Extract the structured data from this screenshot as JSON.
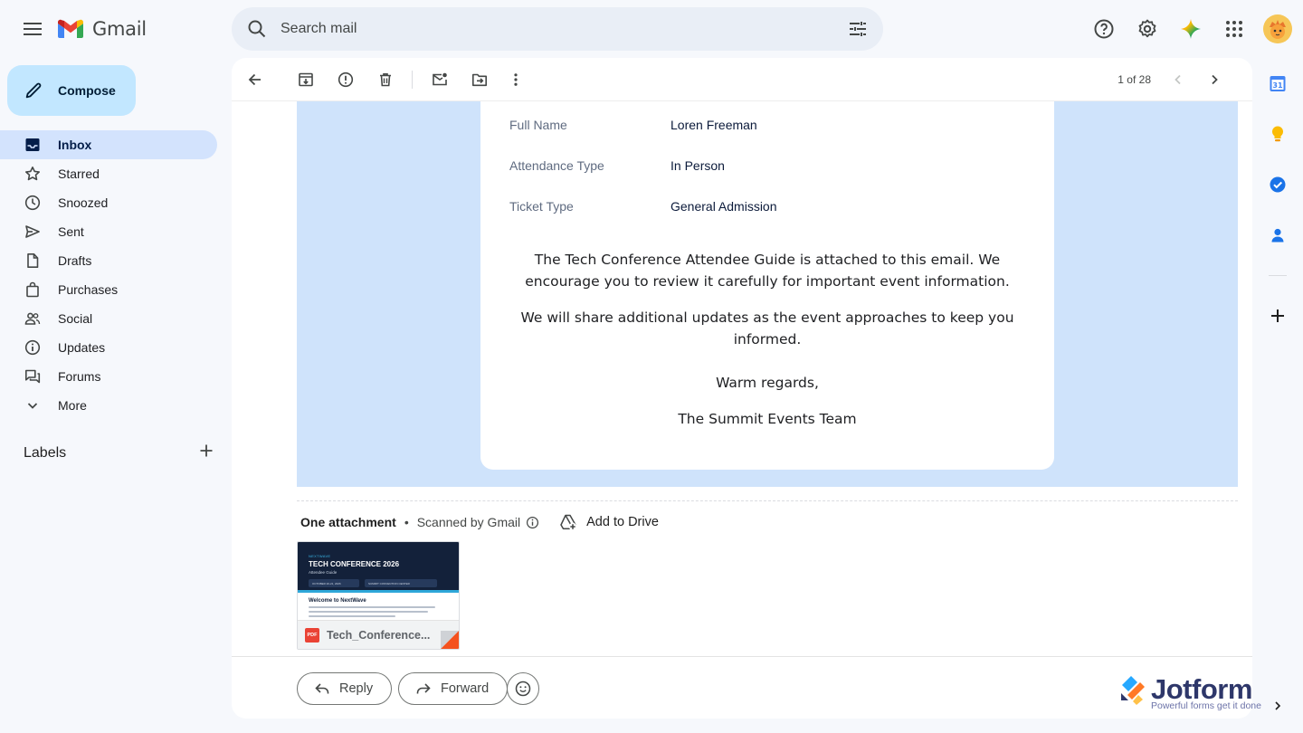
{
  "app": {
    "name": "Gmail"
  },
  "search": {
    "placeholder": "Search mail"
  },
  "compose": {
    "label": "Compose"
  },
  "nav": [
    {
      "label": "Inbox",
      "icon": "inbox-icon",
      "active": true
    },
    {
      "label": "Starred",
      "icon": "star-icon"
    },
    {
      "label": "Snoozed",
      "icon": "clock-icon"
    },
    {
      "label": "Sent",
      "icon": "send-icon"
    },
    {
      "label": "Drafts",
      "icon": "draft-icon"
    },
    {
      "label": "Purchases",
      "icon": "bag-icon"
    },
    {
      "label": "Social",
      "icon": "people-icon"
    },
    {
      "label": "Updates",
      "icon": "info-icon"
    },
    {
      "label": "Forums",
      "icon": "forum-icon"
    },
    {
      "label": "More",
      "icon": "chevron-down-icon"
    }
  ],
  "labels": {
    "title": "Labels"
  },
  "toolbar": {
    "pager": "1 of 28"
  },
  "email": {
    "fields": [
      {
        "key": "Full Name",
        "value": "Loren Freeman"
      },
      {
        "key": "Attendance Type",
        "value": "In Person"
      },
      {
        "key": "Ticket Type",
        "value": "General Admission"
      }
    ],
    "para1": "The Tech Conference Attendee Guide is attached to this email. We encourage you to review it carefully for important event information.",
    "para2": "We will share additional updates as the event approaches to keep you informed.",
    "closing": "Warm regards,",
    "signature": "The Summit Events Team"
  },
  "attachments": {
    "title": "One attachment",
    "scanned": "Scanned by Gmail",
    "add_to_drive": "Add to Drive",
    "file_name": "Tech_Conference...",
    "file_type": "PDF",
    "preview": {
      "kicker": "NEXTWAVE",
      "title": "TECH CONFERENCE 2026",
      "subtitle": "Attendee Guide",
      "pill1": "OCTOBER 20-21, 2026",
      "pill2": "SUMMIT CONVENTION CENTER",
      "heading": "Welcome to NextWave"
    }
  },
  "actions": {
    "reply": "Reply",
    "forward": "Forward"
  },
  "side_panel": {
    "calendar_day": "31"
  },
  "watermark": {
    "brand": "Jotform",
    "tagline": "Powerful forms get it done"
  },
  "colors": {
    "accent": "#c2e7ff",
    "active_nav": "#d3e3fd",
    "email_bg": "#cfe3fb"
  }
}
